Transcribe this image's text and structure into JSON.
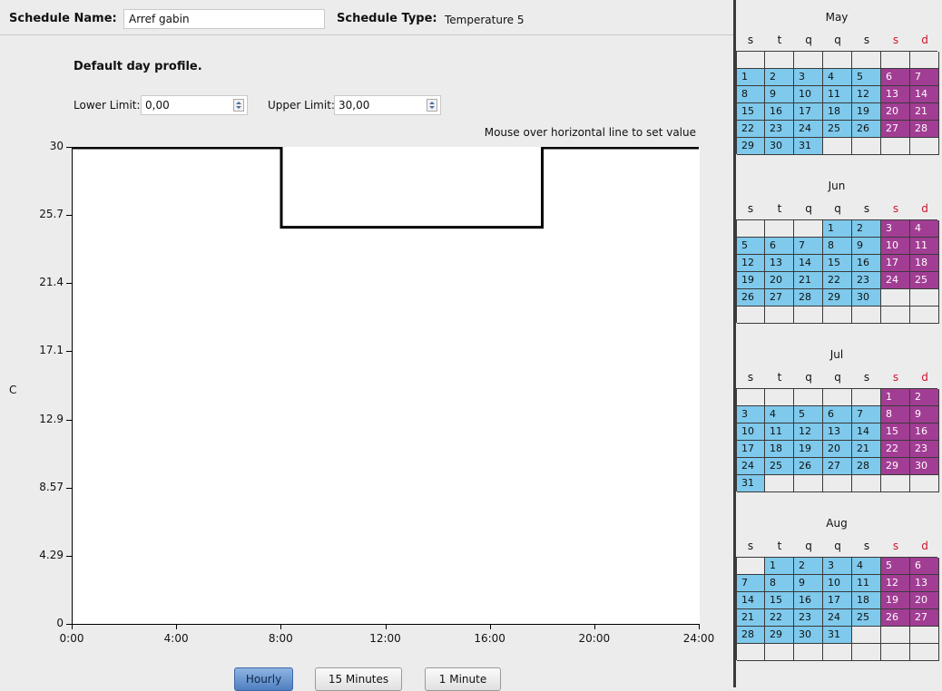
{
  "header": {
    "schedule_name_label": "Schedule Name:",
    "schedule_name_value": "Arref gabin",
    "schedule_type_label": "Schedule Type:",
    "schedule_type_value": "Temperature 5"
  },
  "profile": {
    "title": "Default day profile.",
    "lower_limit_label": "Lower Limit:",
    "lower_limit_value": "0,00",
    "upper_limit_label": "Upper Limit:",
    "upper_limit_value": "30,00",
    "hint": "Mouse over horizontal line to set value"
  },
  "chart_data": {
    "type": "line",
    "step": true,
    "ylabel": "C",
    "ylim": [
      0,
      30
    ],
    "yticks": [
      "30",
      "25.7",
      "21.4",
      "17.1",
      "12.9",
      "8.57",
      "4.29",
      "0"
    ],
    "xticks": [
      "0:00",
      "4:00",
      "8:00",
      "12:00",
      "16:00",
      "20:00",
      "24:00"
    ],
    "xlim": [
      0,
      24
    ],
    "series": [
      {
        "points": [
          [
            0,
            30
          ],
          [
            8,
            30
          ],
          [
            8,
            25
          ],
          [
            18,
            25
          ],
          [
            18,
            30
          ],
          [
            24,
            30
          ]
        ]
      }
    ]
  },
  "resolution_buttons": [
    {
      "label": "Hourly",
      "active": true
    },
    {
      "label": "15 Minutes",
      "active": false
    },
    {
      "label": "1 Minute",
      "active": false
    }
  ],
  "colors": {
    "weekday": "#7ec9ec",
    "weekend": "#a23d94",
    "weekend_header": "#d0142c"
  },
  "calendar": {
    "weekday_headers": [
      "s",
      "t",
      "q",
      "q",
      "s",
      "s",
      "d"
    ],
    "months": [
      {
        "name": "May",
        "rows": [
          [
            "",
            "",
            "",
            "",
            "",
            "",
            ""
          ],
          [
            "1",
            "2",
            "3",
            "4",
            "5",
            "6",
            "7"
          ],
          [
            "8",
            "9",
            "10",
            "11",
            "12",
            "13",
            "14"
          ],
          [
            "15",
            "16",
            "17",
            "18",
            "19",
            "20",
            "21"
          ],
          [
            "22",
            "23",
            "24",
            "25",
            "26",
            "27",
            "28"
          ],
          [
            "29",
            "30",
            "31",
            "",
            "",
            "",
            ""
          ]
        ]
      },
      {
        "name": "Jun",
        "rows": [
          [
            "",
            "",
            "",
            "1",
            "2",
            "3",
            "4"
          ],
          [
            "5",
            "6",
            "7",
            "8",
            "9",
            "10",
            "11"
          ],
          [
            "12",
            "13",
            "14",
            "15",
            "16",
            "17",
            "18"
          ],
          [
            "19",
            "20",
            "21",
            "22",
            "23",
            "24",
            "25"
          ],
          [
            "26",
            "27",
            "28",
            "29",
            "30",
            "",
            ""
          ],
          [
            "",
            "",
            "",
            "",
            "",
            "",
            ""
          ]
        ]
      },
      {
        "name": "Jul",
        "rows": [
          [
            "",
            "",
            "",
            "",
            "",
            "1",
            "2"
          ],
          [
            "3",
            "4",
            "5",
            "6",
            "7",
            "8",
            "9"
          ],
          [
            "10",
            "11",
            "12",
            "13",
            "14",
            "15",
            "16"
          ],
          [
            "17",
            "18",
            "19",
            "20",
            "21",
            "22",
            "23"
          ],
          [
            "24",
            "25",
            "26",
            "27",
            "28",
            "29",
            "30"
          ],
          [
            "31",
            "",
            "",
            "",
            "",
            "",
            ""
          ]
        ]
      },
      {
        "name": "Aug",
        "rows": [
          [
            "",
            "1",
            "2",
            "3",
            "4",
            "5",
            "6"
          ],
          [
            "7",
            "8",
            "9",
            "10",
            "11",
            "12",
            "13"
          ],
          [
            "14",
            "15",
            "16",
            "17",
            "18",
            "19",
            "20"
          ],
          [
            "21",
            "22",
            "23",
            "24",
            "25",
            "26",
            "27"
          ],
          [
            "28",
            "29",
            "30",
            "31",
            "",
            "",
            ""
          ],
          [
            "",
            "",
            "",
            "",
            "",
            "",
            ""
          ]
        ]
      }
    ]
  }
}
